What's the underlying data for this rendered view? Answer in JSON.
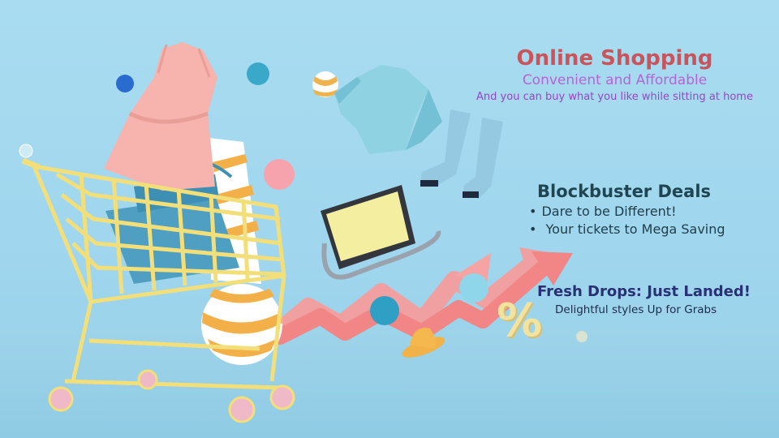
{
  "hero": {
    "title": "Online Shopping",
    "subtitle": "Convenient and Affordable",
    "tagline": "And you can buy what you like while  sitting at home"
  },
  "deals": {
    "title": "Blockbuster Deals",
    "bullet": "•",
    "items": [
      "Dare to be Different!",
      "Your tickets to Mega Saving"
    ]
  },
  "drops": {
    "title": "Fresh Drops: Just Landed!",
    "subtitle": "Delightful styles Up for Grabs"
  },
  "decor": {
    "percent_symbol": "%"
  },
  "colors": {
    "background": "#a9dcf0",
    "title": "#c8545c",
    "subtitle": "#b763d6",
    "deals_title": "#1f4550",
    "drops_title": "#2a3075",
    "cart": "#f3df7a",
    "arrow": "#f08a8a"
  }
}
